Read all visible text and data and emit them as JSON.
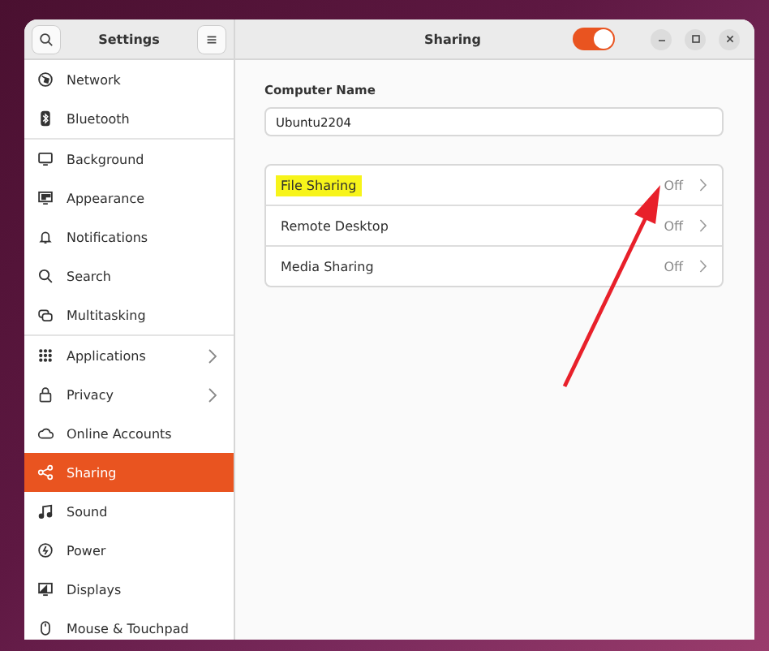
{
  "sidebar": {
    "title": "Settings",
    "groups": [
      {
        "items": [
          {
            "label": "Network",
            "selected": false,
            "submenu": false
          },
          {
            "label": "Bluetooth",
            "selected": false,
            "submenu": false
          }
        ]
      },
      {
        "items": [
          {
            "label": "Background",
            "selected": false,
            "submenu": false
          },
          {
            "label": "Appearance",
            "selected": false,
            "submenu": false
          },
          {
            "label": "Notifications",
            "selected": false,
            "submenu": false
          },
          {
            "label": "Search",
            "selected": false,
            "submenu": false
          },
          {
            "label": "Multitasking",
            "selected": false,
            "submenu": false
          }
        ]
      },
      {
        "items": [
          {
            "label": "Applications",
            "selected": false,
            "submenu": true
          },
          {
            "label": "Privacy",
            "selected": false,
            "submenu": true
          },
          {
            "label": "Online Accounts",
            "selected": false,
            "submenu": false
          },
          {
            "label": "Sharing",
            "selected": true,
            "submenu": false
          },
          {
            "label": "Sound",
            "selected": false,
            "submenu": false
          },
          {
            "label": "Power",
            "selected": false,
            "submenu": false
          },
          {
            "label": "Displays",
            "selected": false,
            "submenu": false
          },
          {
            "label": "Mouse & Touchpad",
            "selected": false,
            "submenu": false
          }
        ]
      }
    ]
  },
  "page": {
    "title": "Sharing",
    "sharing_switch": {
      "on": true
    },
    "computer_name": {
      "label": "Computer Name",
      "value": "Ubuntu2204"
    },
    "services": [
      {
        "label": "File Sharing",
        "status": "Off",
        "highlighted": true
      },
      {
        "label": "Remote Desktop",
        "status": "Off",
        "highlighted": false
      },
      {
        "label": "Media Sharing",
        "status": "Off",
        "highlighted": false
      }
    ]
  }
}
